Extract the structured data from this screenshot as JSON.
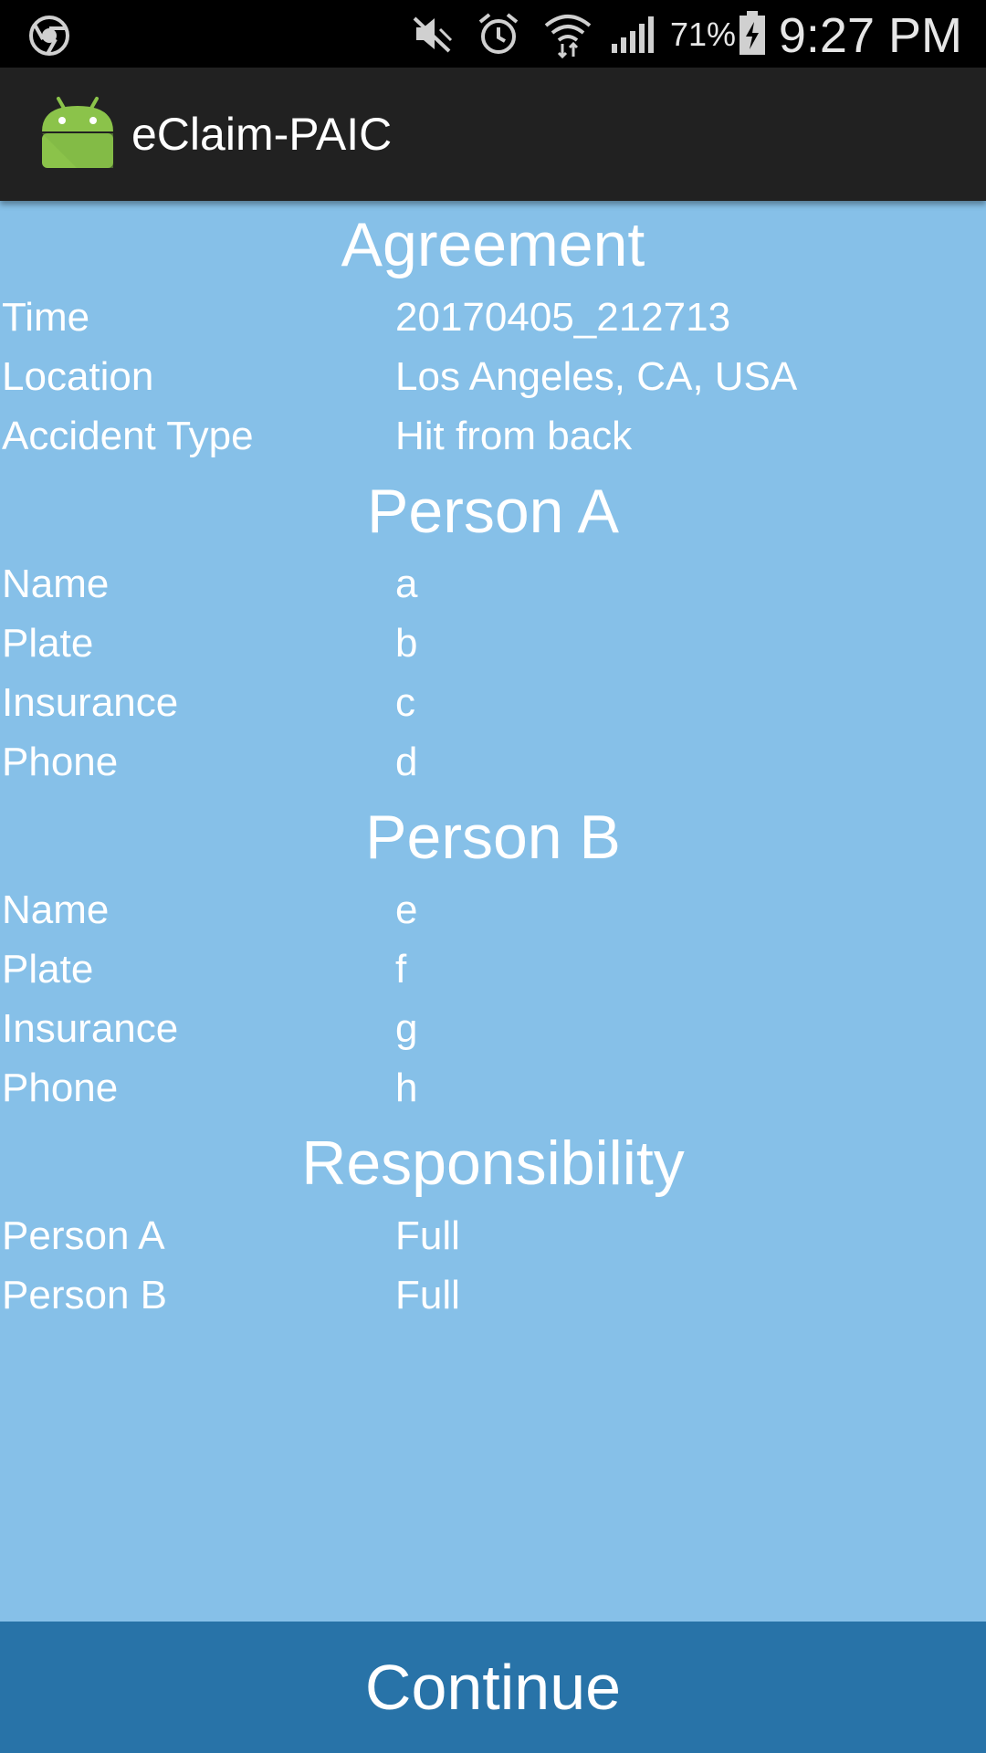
{
  "status_bar": {
    "battery_percent": "71%",
    "time": "9:27 PM",
    "icons": [
      "chrome-icon",
      "mute-icon",
      "alarm-icon",
      "wifi-icon",
      "signal-icon",
      "battery-charging-icon"
    ]
  },
  "action_bar": {
    "title": "eClaim-PAIC",
    "icon": "android-icon"
  },
  "agreement": {
    "title": "Agreement",
    "rows": [
      {
        "label": "Time",
        "value": "20170405_212713"
      },
      {
        "label": "Location",
        "value": "Los Angeles, CA, USA"
      },
      {
        "label": "Accident Type",
        "value": "Hit from back"
      }
    ]
  },
  "person_a": {
    "title": "Person A",
    "rows": [
      {
        "label": "Name",
        "value": "a"
      },
      {
        "label": "Plate",
        "value": "b"
      },
      {
        "label": "Insurance",
        "value": "c"
      },
      {
        "label": "Phone",
        "value": "d"
      }
    ]
  },
  "person_b": {
    "title": "Person B",
    "rows": [
      {
        "label": "Name",
        "value": "e"
      },
      {
        "label": "Plate",
        "value": "f"
      },
      {
        "label": "Insurance",
        "value": "g"
      },
      {
        "label": "Phone",
        "value": "h"
      }
    ]
  },
  "responsibility": {
    "title": "Responsibility",
    "rows": [
      {
        "label": "Person A",
        "value": "Full"
      },
      {
        "label": "Person B",
        "value": "Full"
      }
    ]
  },
  "continue_label": "Continue",
  "colors": {
    "background": "#86c0e8",
    "button": "#2873a8",
    "action_bar": "#212121",
    "status_bar": "#000000",
    "android_green": "#8bc34a"
  }
}
